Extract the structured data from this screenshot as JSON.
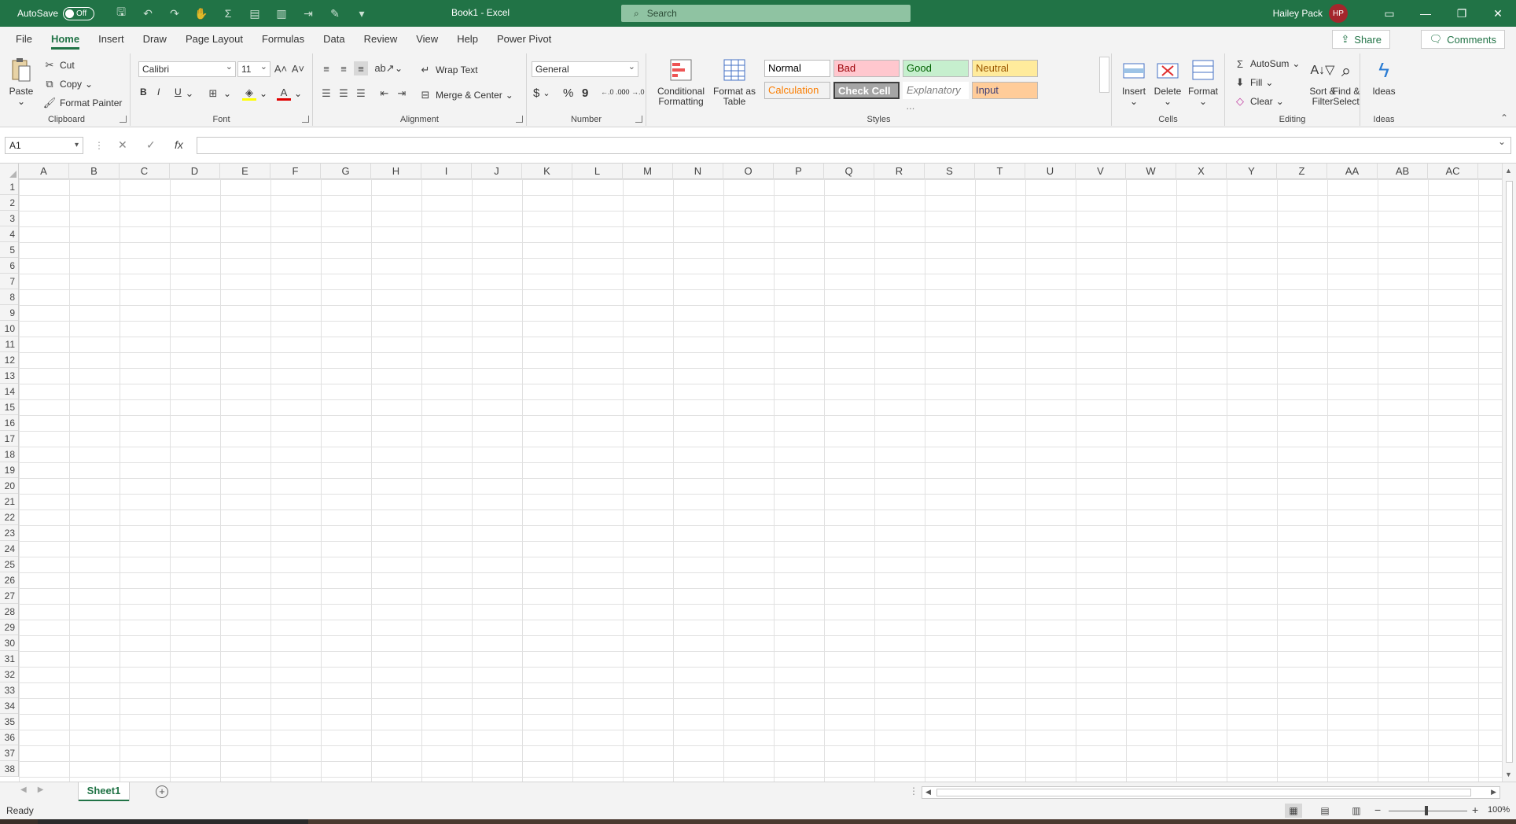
{
  "titlebar": {
    "autosave_label": "AutoSave",
    "autosave_state": "Off",
    "doc_title": "Book1 - Excel",
    "search_placeholder": "Search",
    "user_name": "Hailey Pack",
    "user_initials": "HP",
    "accent": "#217346"
  },
  "tabs": [
    "File",
    "Home",
    "Insert",
    "Draw",
    "Page Layout",
    "Formulas",
    "Data",
    "Review",
    "View",
    "Help",
    "Power Pivot"
  ],
  "active_tab": "Home",
  "share_label": "Share",
  "comments_label": "Comments",
  "ribbon": {
    "clipboard": {
      "label": "Clipboard",
      "paste": "Paste",
      "cut": "Cut",
      "copy": "Copy",
      "format_painter": "Format Painter"
    },
    "font": {
      "label": "Font",
      "font_name": "Calibri",
      "font_size": "11",
      "bold": "B",
      "italic": "I",
      "underline": "U"
    },
    "alignment": {
      "label": "Alignment",
      "wrap_text": "Wrap Text",
      "merge_center": "Merge & Center"
    },
    "number": {
      "label": "Number",
      "format": "General",
      "currency": "$",
      "percent": "%",
      "comma": "9",
      "inc_decimal": "←.0 .00",
      "dec_decimal": ".00 →.0"
    },
    "styles": {
      "label": "Styles",
      "conditional_formatting": "Conditional Formatting",
      "format_as_table": "Format as Table",
      "cells": [
        {
          "name": "Normal",
          "bg": "#ffffff",
          "fg": "#000000"
        },
        {
          "name": "Bad",
          "bg": "#ffc7ce",
          "fg": "#9c0006"
        },
        {
          "name": "Good",
          "bg": "#c6efce",
          "fg": "#006100"
        },
        {
          "name": "Neutral",
          "bg": "#ffeb9c",
          "fg": "#9c5700"
        },
        {
          "name": "Calculation",
          "bg": "#f2f2f2",
          "fg": "#fa7d00"
        },
        {
          "name": "Check Cell",
          "bg": "#a5a5a5",
          "fg": "#ffffff"
        },
        {
          "name": "Explanatory ...",
          "bg": "#ffffff",
          "fg": "#7f7f7f"
        },
        {
          "name": "Input",
          "bg": "#ffcc99",
          "fg": "#3f3f76"
        }
      ]
    },
    "cells": {
      "label": "Cells",
      "insert": "Insert",
      "delete": "Delete",
      "format": "Format"
    },
    "editing": {
      "label": "Editing",
      "autosum": "AutoSum",
      "fill": "Fill",
      "clear": "Clear",
      "sort_filter": "Sort & Filter",
      "find_select": "Find & Select"
    },
    "ideas": {
      "label": "Ideas",
      "button": "Ideas"
    }
  },
  "formula_bar": {
    "name_box": "A1",
    "fx": "fx",
    "value": ""
  },
  "columns": [
    "A",
    "B",
    "C",
    "D",
    "E",
    "F",
    "G",
    "H",
    "I",
    "J",
    "K",
    "L",
    "M",
    "N",
    "O",
    "P",
    "Q",
    "R",
    "S",
    "T",
    "U",
    "V",
    "W",
    "X",
    "Y",
    "Z",
    "AA",
    "AB",
    "AC"
  ],
  "rows": [
    "1",
    "2",
    "3",
    "4",
    "5",
    "6",
    "7",
    "8",
    "9",
    "10",
    "11",
    "12",
    "13",
    "14",
    "15",
    "16",
    "17",
    "18",
    "19",
    "20",
    "21",
    "22",
    "23",
    "24",
    "25",
    "26",
    "27",
    "28",
    "29",
    "30",
    "31",
    "32",
    "33",
    "34",
    "35",
    "36",
    "37",
    "38"
  ],
  "sheet_tab": "Sheet1",
  "status": {
    "text": "Ready",
    "zoom": "100%"
  }
}
